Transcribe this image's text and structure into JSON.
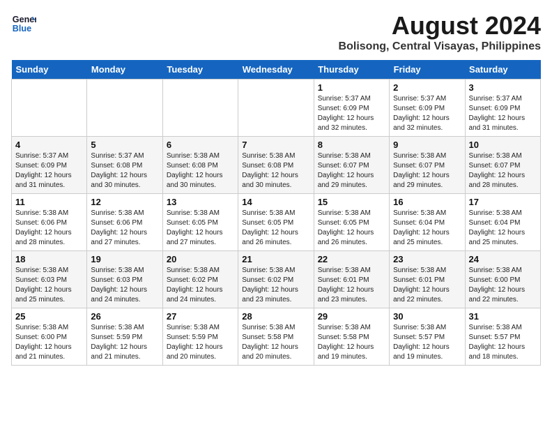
{
  "header": {
    "logo_line1": "General",
    "logo_line2": "Blue",
    "month_year": "August 2024",
    "location": "Bolisong, Central Visayas, Philippines"
  },
  "weekdays": [
    "Sunday",
    "Monday",
    "Tuesday",
    "Wednesday",
    "Thursday",
    "Friday",
    "Saturday"
  ],
  "weeks": [
    [
      {
        "day": "",
        "info": ""
      },
      {
        "day": "",
        "info": ""
      },
      {
        "day": "",
        "info": ""
      },
      {
        "day": "",
        "info": ""
      },
      {
        "day": "1",
        "info": "Sunrise: 5:37 AM\nSunset: 6:09 PM\nDaylight: 12 hours\nand 32 minutes."
      },
      {
        "day": "2",
        "info": "Sunrise: 5:37 AM\nSunset: 6:09 PM\nDaylight: 12 hours\nand 32 minutes."
      },
      {
        "day": "3",
        "info": "Sunrise: 5:37 AM\nSunset: 6:09 PM\nDaylight: 12 hours\nand 31 minutes."
      }
    ],
    [
      {
        "day": "4",
        "info": "Sunrise: 5:37 AM\nSunset: 6:09 PM\nDaylight: 12 hours\nand 31 minutes."
      },
      {
        "day": "5",
        "info": "Sunrise: 5:37 AM\nSunset: 6:08 PM\nDaylight: 12 hours\nand 30 minutes."
      },
      {
        "day": "6",
        "info": "Sunrise: 5:38 AM\nSunset: 6:08 PM\nDaylight: 12 hours\nand 30 minutes."
      },
      {
        "day": "7",
        "info": "Sunrise: 5:38 AM\nSunset: 6:08 PM\nDaylight: 12 hours\nand 30 minutes."
      },
      {
        "day": "8",
        "info": "Sunrise: 5:38 AM\nSunset: 6:07 PM\nDaylight: 12 hours\nand 29 minutes."
      },
      {
        "day": "9",
        "info": "Sunrise: 5:38 AM\nSunset: 6:07 PM\nDaylight: 12 hours\nand 29 minutes."
      },
      {
        "day": "10",
        "info": "Sunrise: 5:38 AM\nSunset: 6:07 PM\nDaylight: 12 hours\nand 28 minutes."
      }
    ],
    [
      {
        "day": "11",
        "info": "Sunrise: 5:38 AM\nSunset: 6:06 PM\nDaylight: 12 hours\nand 28 minutes."
      },
      {
        "day": "12",
        "info": "Sunrise: 5:38 AM\nSunset: 6:06 PM\nDaylight: 12 hours\nand 27 minutes."
      },
      {
        "day": "13",
        "info": "Sunrise: 5:38 AM\nSunset: 6:05 PM\nDaylight: 12 hours\nand 27 minutes."
      },
      {
        "day": "14",
        "info": "Sunrise: 5:38 AM\nSunset: 6:05 PM\nDaylight: 12 hours\nand 26 minutes."
      },
      {
        "day": "15",
        "info": "Sunrise: 5:38 AM\nSunset: 6:05 PM\nDaylight: 12 hours\nand 26 minutes."
      },
      {
        "day": "16",
        "info": "Sunrise: 5:38 AM\nSunset: 6:04 PM\nDaylight: 12 hours\nand 25 minutes."
      },
      {
        "day": "17",
        "info": "Sunrise: 5:38 AM\nSunset: 6:04 PM\nDaylight: 12 hours\nand 25 minutes."
      }
    ],
    [
      {
        "day": "18",
        "info": "Sunrise: 5:38 AM\nSunset: 6:03 PM\nDaylight: 12 hours\nand 25 minutes."
      },
      {
        "day": "19",
        "info": "Sunrise: 5:38 AM\nSunset: 6:03 PM\nDaylight: 12 hours\nand 24 minutes."
      },
      {
        "day": "20",
        "info": "Sunrise: 5:38 AM\nSunset: 6:02 PM\nDaylight: 12 hours\nand 24 minutes."
      },
      {
        "day": "21",
        "info": "Sunrise: 5:38 AM\nSunset: 6:02 PM\nDaylight: 12 hours\nand 23 minutes."
      },
      {
        "day": "22",
        "info": "Sunrise: 5:38 AM\nSunset: 6:01 PM\nDaylight: 12 hours\nand 23 minutes."
      },
      {
        "day": "23",
        "info": "Sunrise: 5:38 AM\nSunset: 6:01 PM\nDaylight: 12 hours\nand 22 minutes."
      },
      {
        "day": "24",
        "info": "Sunrise: 5:38 AM\nSunset: 6:00 PM\nDaylight: 12 hours\nand 22 minutes."
      }
    ],
    [
      {
        "day": "25",
        "info": "Sunrise: 5:38 AM\nSunset: 6:00 PM\nDaylight: 12 hours\nand 21 minutes."
      },
      {
        "day": "26",
        "info": "Sunrise: 5:38 AM\nSunset: 5:59 PM\nDaylight: 12 hours\nand 21 minutes."
      },
      {
        "day": "27",
        "info": "Sunrise: 5:38 AM\nSunset: 5:59 PM\nDaylight: 12 hours\nand 20 minutes."
      },
      {
        "day": "28",
        "info": "Sunrise: 5:38 AM\nSunset: 5:58 PM\nDaylight: 12 hours\nand 20 minutes."
      },
      {
        "day": "29",
        "info": "Sunrise: 5:38 AM\nSunset: 5:58 PM\nDaylight: 12 hours\nand 19 minutes."
      },
      {
        "day": "30",
        "info": "Sunrise: 5:38 AM\nSunset: 5:57 PM\nDaylight: 12 hours\nand 19 minutes."
      },
      {
        "day": "31",
        "info": "Sunrise: 5:38 AM\nSunset: 5:57 PM\nDaylight: 12 hours\nand 18 minutes."
      }
    ]
  ]
}
